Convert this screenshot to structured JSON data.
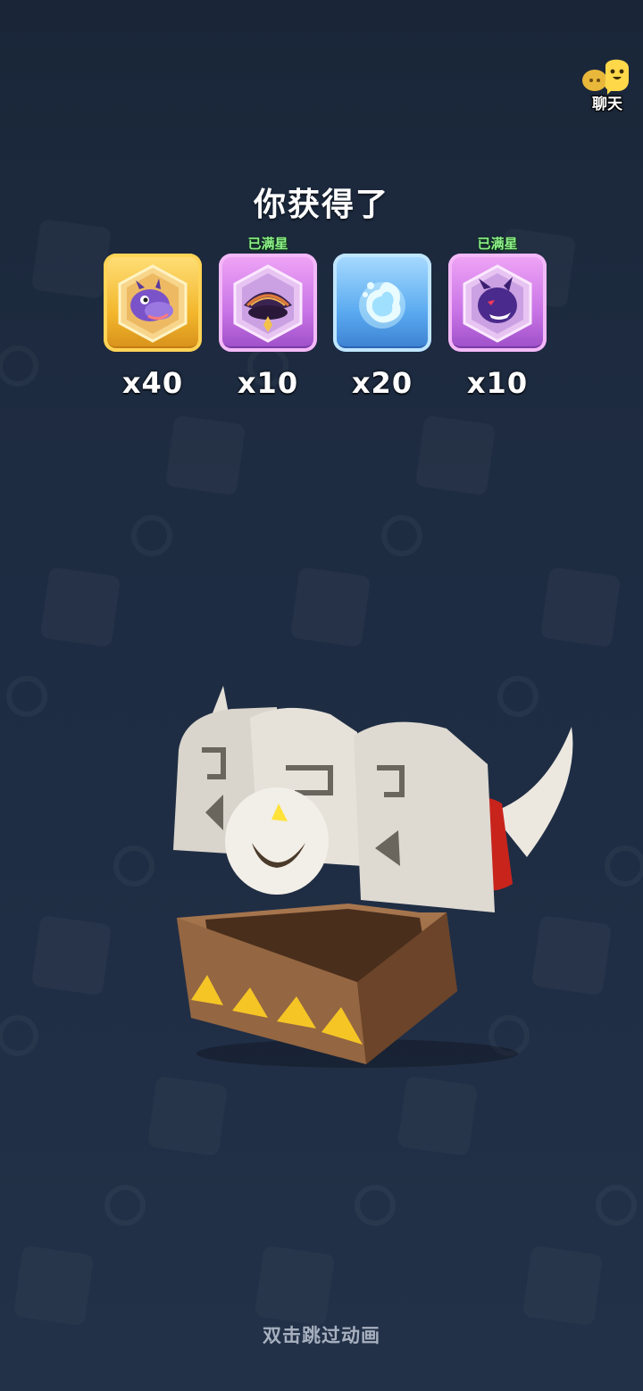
{
  "chat": {
    "label": "聊天",
    "icon": "chat-bubble-icon"
  },
  "title": "你获得了",
  "rewards": [
    {
      "name": "dragon-card",
      "count": "x40",
      "badge": "",
      "rarity_color": "#f3b72c"
    },
    {
      "name": "shell-card",
      "count": "x10",
      "badge": "已满星",
      "rarity_color": "#c873e6"
    },
    {
      "name": "spirit-orb",
      "count": "x20",
      "badge": "",
      "rarity_color": "#5aaaf0"
    },
    {
      "name": "dark-dragon-card",
      "count": "x10",
      "badge": "已满星",
      "rarity_color": "#c873e6"
    }
  ],
  "hint": "双击跳过动画",
  "colors": {
    "background": "#1e2c42",
    "badge_green": "#8ef08a"
  }
}
